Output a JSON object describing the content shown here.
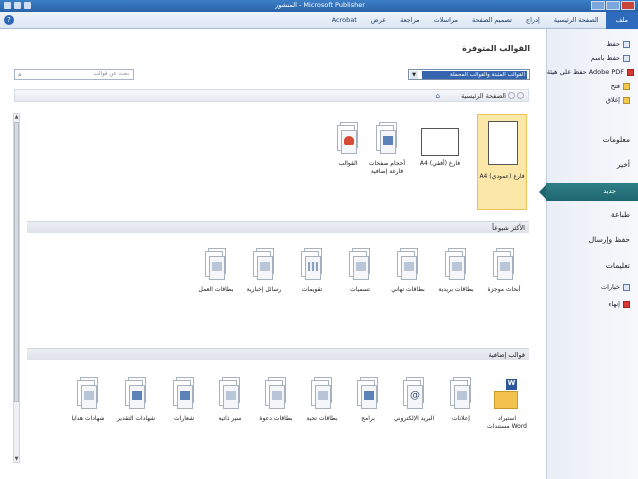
{
  "window": {
    "title": "المنشور - Microsoft Publisher"
  },
  "ribbon": {
    "tabs": [
      "ملف",
      "الصفحة الرئيسية",
      "إدراج",
      "تصميم الصفحة",
      "مراسلات",
      "مراجعة",
      "عرض",
      "Acrobat"
    ]
  },
  "nav": {
    "items_top": [
      {
        "label": "حفظ",
        "icon": "save-icon"
      },
      {
        "label": "حفظ باسم",
        "icon": "save-as-icon"
      },
      {
        "label": "حفظ على هيئة Adobe PDF",
        "icon": "pdf-icon"
      },
      {
        "label": "فتح",
        "icon": "open-folder-icon"
      },
      {
        "label": "إغلاق",
        "icon": "close-file-icon"
      }
    ],
    "info": "معلومات",
    "recent": "أخير",
    "new": "جديد",
    "print": "طباعة",
    "save_send": "حفظ وإرسال",
    "help": "تعليمات",
    "options": {
      "label": "خيارات",
      "icon": "options-icon"
    },
    "exit": {
      "label": "إنهاء",
      "icon": "exit-icon"
    }
  },
  "main": {
    "heading": "القوالب المتوفرة",
    "source_select": "القوالب المثبتة والقوالب المحملة",
    "search_placeholder": "بحث عن قوالب",
    "breadcrumb": "الصفحة الرئيسية",
    "top_tiles": [
      {
        "label": "A4 فارغ (عمودي)",
        "selected": true
      },
      {
        "label": "A4 فارغ (أفقي)"
      },
      {
        "label": "أحجام صفحات فارغة إضافية"
      },
      {
        "label": "القوالب"
      }
    ],
    "most_popular": {
      "title": "الأكثر شيوعاً",
      "items": [
        "أبحاث موجزة",
        "بطاقات بريدية",
        "بطاقات تهاني",
        "تسميات",
        "تقويمات",
        "رسائل إخبارية",
        "بطاقات العمل"
      ]
    },
    "more_templates": {
      "title": "قوالب إضافية",
      "items": [
        "استيراد مستندات Word",
        "إعلانات",
        "البريد الإلكتروني",
        "برامج",
        "بطاقات تحية",
        "بطاقات دعوة",
        "سير ذاتية",
        "شعارات",
        "شهادات التقدير",
        "شهادات هدايا"
      ]
    }
  }
}
